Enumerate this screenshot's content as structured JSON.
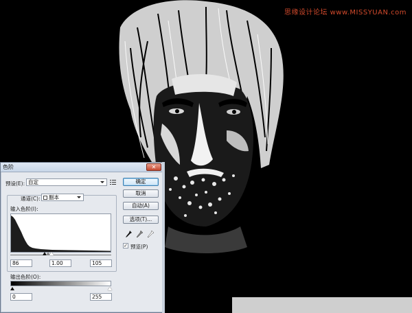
{
  "watermark": "思缘设计论坛 www.MISSYUAN.com",
  "dialog": {
    "title": "色阶",
    "close_label": "✕",
    "preset_label": "预设(E):",
    "preset_value": "自定",
    "preset_menu_icon": "menu-list-icon",
    "channel_label": "通道(C):",
    "channel_value": "副本",
    "input_levels_label": "输入色阶(I):",
    "input_black": "86",
    "input_gamma": "1.00",
    "input_white": "105",
    "output_levels_label": "输出色阶(O):",
    "output_black": "0",
    "output_white": "255",
    "buttons": {
      "ok": "确定",
      "cancel": "取消",
      "auto": "自动(A)",
      "options": "选项(T)..."
    },
    "preview_label": "预览(P)",
    "preview_checked": true,
    "eyedroppers": [
      "black-eyedropper-icon",
      "gray-eyedropper-icon",
      "white-eyedropper-icon"
    ]
  }
}
